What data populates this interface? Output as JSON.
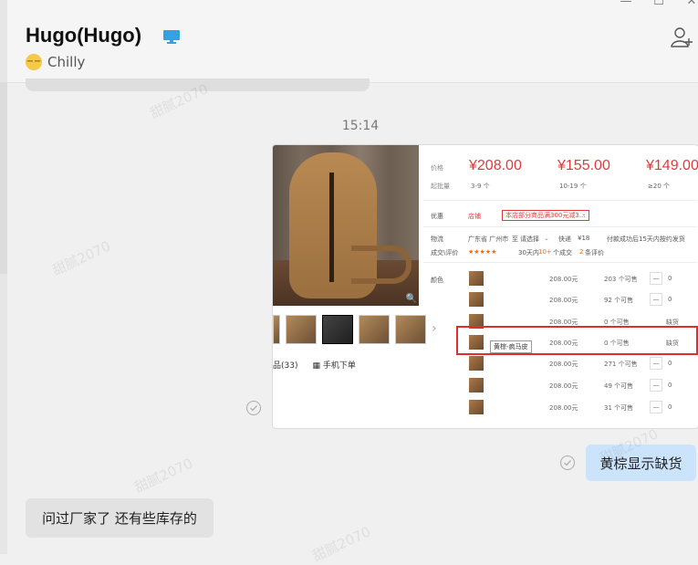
{
  "window": {
    "minimize_glyph": "—",
    "maximize_glyph": "☐",
    "close_glyph": "✕"
  },
  "header": {
    "contact_name": "Hugo(Hugo)",
    "status_text": "Chilly",
    "status_emoji_icon": "neutral-face-icon",
    "device_icon": "desktop-icon",
    "add_contact_icon": "add-user-icon"
  },
  "chat": {
    "timestamp": "15:14"
  },
  "product_card": {
    "price_label": "价格",
    "batch_label": "起批量",
    "prices": [
      {
        "price": "¥208.00",
        "range": "3-9 个"
      },
      {
        "price": "¥155.00",
        "range": "10-19 个"
      },
      {
        "price": "¥149.00",
        "range": "≥20 个"
      }
    ],
    "promo_label": "优惠",
    "promo_link": "店铺",
    "promo_tag": "本店部分商品满300元减3...",
    "shipping_label": "物流",
    "shipping_from": "广东省 广州市",
    "shipping_to_label": "至",
    "shipping_select": "请选择",
    "shipping_type": "快递",
    "shipping_fee": "¥18",
    "shipping_note": "付款成功后15天内按约发货",
    "review_label": "成交\\评价",
    "stars": "★★★★★",
    "sales_text": "30天内",
    "sales_count": "10+",
    "sales_unit": "个成交",
    "review_count": "2",
    "review_unit": "条评价",
    "color_label": "颜色",
    "variants": [
      {
        "price": "208.00元",
        "stock": "203 个可售",
        "qty": "0",
        "out_of_stock": ""
      },
      {
        "price": "208.00元",
        "stock": "92 个可售",
        "qty": "0",
        "out_of_stock": ""
      },
      {
        "price": "208.00元",
        "stock": "0 个可售",
        "qty": "",
        "out_of_stock": "缺货"
      },
      {
        "price": "208.00元",
        "stock": "0 个可售",
        "qty": "",
        "out_of_stock": "缺货"
      },
      {
        "price": "208.00元",
        "stock": "271 个可售",
        "qty": "0",
        "out_of_stock": ""
      },
      {
        "price": "208.00元",
        "stock": "49 个可售",
        "qty": "0",
        "out_of_stock": ""
      },
      {
        "price": "208.00元",
        "stock": "31 个可售",
        "qty": "0",
        "out_of_stock": ""
      }
    ],
    "highlighted_variant_tooltip": "黄棕-疯马皮",
    "minus_glyph": "—",
    "footer_left": "品(33)",
    "footer_mobile": "手机下单"
  },
  "messages": {
    "mine": "黄棕显示缺货",
    "theirs": "问过厂家了 还有些库存的"
  },
  "watermark": "甜腻2070",
  "colors": {
    "accent_price": "#e4393c",
    "my_bubble": "#cbe3fb",
    "their_bubble": "#e2e2e2",
    "highlight_box": "#e02d2d"
  }
}
